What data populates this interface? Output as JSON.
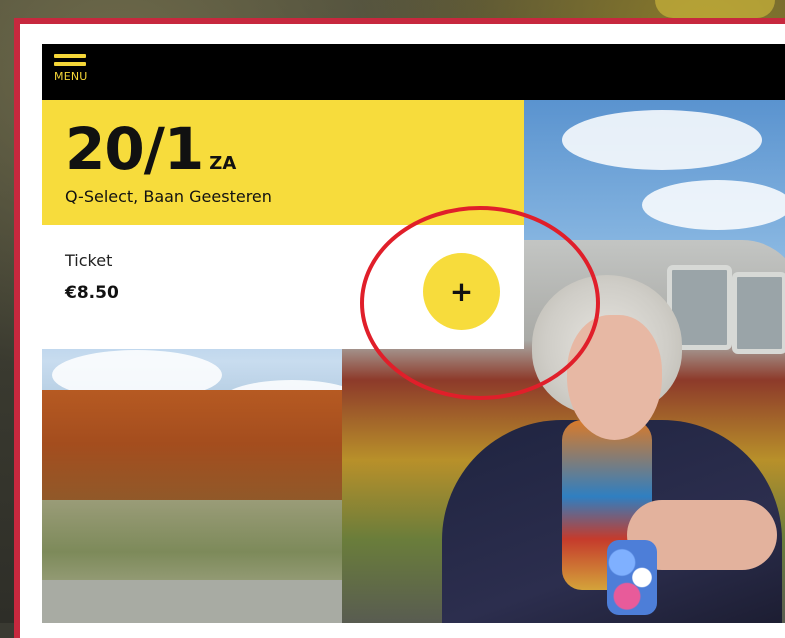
{
  "menu": {
    "label": "MENU",
    "icon": "hamburger-icon"
  },
  "event": {
    "date": "20/1",
    "weekday": "ZA",
    "venue": "Q-Select, Baan Geesteren"
  },
  "ticket": {
    "label": "Ticket",
    "price": "€8.50",
    "add_symbol": "+"
  },
  "colors": {
    "accent_yellow": "#f7dc3c",
    "frame_red": "#c7283e",
    "annotation_red": "#e01f2a",
    "topbar": "#000000"
  }
}
